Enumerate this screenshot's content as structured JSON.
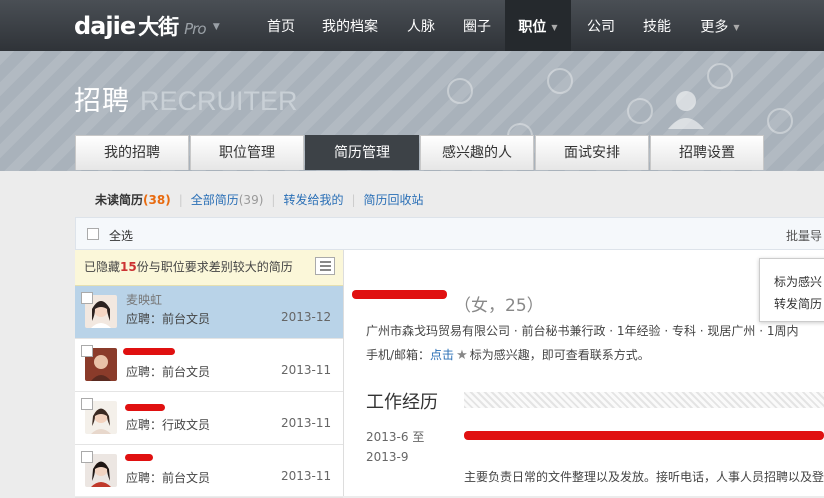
{
  "topnav": {
    "logo_text": "dajie",
    "logo_cn": "大街",
    "logo_pro": "Pro",
    "items": [
      {
        "label": "首页"
      },
      {
        "label": "我的档案"
      },
      {
        "label": "人脉"
      },
      {
        "label": "圈子"
      },
      {
        "label": "职位"
      },
      {
        "label": "公司"
      },
      {
        "label": "技能"
      },
      {
        "label": "更多"
      }
    ]
  },
  "banner": {
    "title_cn": "招聘",
    "title_en": "RECRUITER"
  },
  "tabs": [
    {
      "label": "我的招聘"
    },
    {
      "label": "职位管理"
    },
    {
      "label": "简历管理"
    },
    {
      "label": "感兴趣的人"
    },
    {
      "label": "面试安排"
    },
    {
      "label": "招聘设置"
    }
  ],
  "subnav": {
    "unread_label": "未读简历",
    "unread_count": "(38)",
    "all_label": "全部简历",
    "all_count": "(39)",
    "forwarded_label": "转发给我的",
    "recycle_label": "简历回收站"
  },
  "select_bar": {
    "select_all": "全选",
    "batch": "批量导"
  },
  "hidden_note": {
    "prefix": "已隐藏",
    "count": "15",
    "suffix": "份与职位要求差别较大的简历"
  },
  "candidates": [
    {
      "name": "麦映虹",
      "apply": "应聘：前台文员",
      "date": "2013-12"
    },
    {
      "name": "",
      "apply": "应聘：前台文员",
      "date": "2013-11"
    },
    {
      "name": "",
      "apply": "应聘：行政文员",
      "date": "2013-11"
    },
    {
      "name": "",
      "apply": "应聘：前台文员",
      "date": "2013-11"
    }
  ],
  "detail": {
    "meta": "（女，25）",
    "info": "广州市森戈玛贸易有限公司 · 前台秘书兼行政 · 1年经验 · 专科 · 现居广州 · 1周内",
    "contact_label": "手机/邮箱：",
    "contact_link": "点击",
    "contact_rest": "标为感兴趣，即可查看联系方式。",
    "section_title": "工作经历",
    "exp_date_1": "2013-6 至",
    "exp_date_2": "2013-9",
    "exp_desc": "主要负责日常的文件整理以及发放。接听电话，人事人员招聘以及登"
  },
  "popup": {
    "item1": "标为感兴",
    "item2": "转发简历"
  },
  "colors": {
    "accent": "#e86b10",
    "link": "#2a6fb6",
    "selected_row": "#b9d3e8",
    "redaction": "#e01010"
  }
}
